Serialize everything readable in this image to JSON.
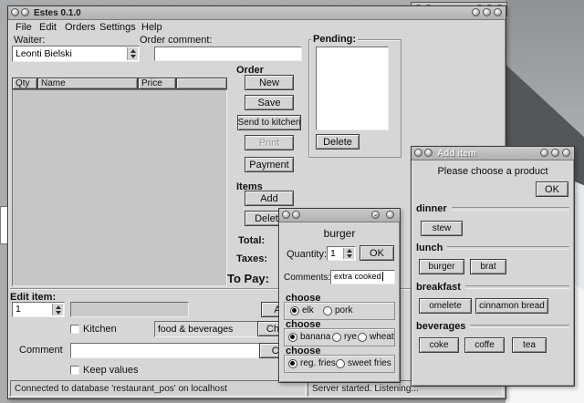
{
  "palette": {
    "desktop": "#a9abad",
    "window_bg": "#d6d6d6",
    "titlebar": "#bdbdbd",
    "entry_bg": "#ffffff",
    "table_bg": "#c6c6c6"
  },
  "main": {
    "title": "Estes 0.1.0",
    "menu": [
      "File",
      "Edit",
      "Orders",
      "Settings",
      "Help"
    ],
    "waiter_label": "Waiter:",
    "waiter_value": "Leonti Bielski",
    "order_comment_label": "Order comment:",
    "order_comment_value": "",
    "table_headers": [
      "Qty",
      "Name",
      "Price"
    ],
    "pending_label": "Pending:",
    "pending_delete_button": "Delete",
    "order_section_label": "Order",
    "order_buttons": [
      "New",
      "Save",
      "Send to kitchen",
      "Print",
      "Payment"
    ],
    "items_section_label": "Items",
    "items_buttons": [
      "Add",
      "Delete"
    ],
    "total_label": "Total:",
    "taxes_label": "Taxes:",
    "to_pay_label": "To Pay:",
    "edit_item_label": "Edit item:",
    "edit_quantity_value": "1",
    "kitchen_checkbox_label": "Kitchen",
    "category_value": "food & beverages",
    "comment_label": "Comment",
    "keep_values_label": "Keep values",
    "edit_buttons_partial": [
      "A",
      "Cha",
      "Cl"
    ],
    "status_left": "Connected to database 'restaurant_pos' on localhost",
    "status_right": "Server started. Listening..."
  },
  "burger": {
    "heading": "burger",
    "quantity_label": "Quantity:",
    "quantity_value": "1",
    "ok_button": "OK",
    "comments_label": "Comments:",
    "comments_value": "extra cooked",
    "groups": [
      {
        "label": "choose",
        "options": [
          {
            "text": "elk",
            "selected": true
          },
          {
            "text": "pork",
            "selected": false
          }
        ]
      },
      {
        "label": "choose",
        "options": [
          {
            "text": "banana",
            "selected": true
          },
          {
            "text": "rye",
            "selected": false
          },
          {
            "text": "wheat",
            "selected": false
          }
        ]
      },
      {
        "label": "choose",
        "options": [
          {
            "text": "reg. fries",
            "selected": true
          },
          {
            "text": "sweet fries",
            "selected": false
          }
        ]
      }
    ]
  },
  "add_item": {
    "title": "Add item",
    "subtitle": "Please choose a product",
    "ok_button": "OK",
    "categories": [
      {
        "name": "dinner",
        "products": [
          "stew"
        ]
      },
      {
        "name": "lunch",
        "products": [
          "burger",
          "brat"
        ]
      },
      {
        "name": "breakfast",
        "products": [
          "omelete",
          "cinnamon bread"
        ]
      },
      {
        "name": "beverages",
        "products": [
          "coke",
          "coffe",
          "tea"
        ]
      }
    ]
  }
}
